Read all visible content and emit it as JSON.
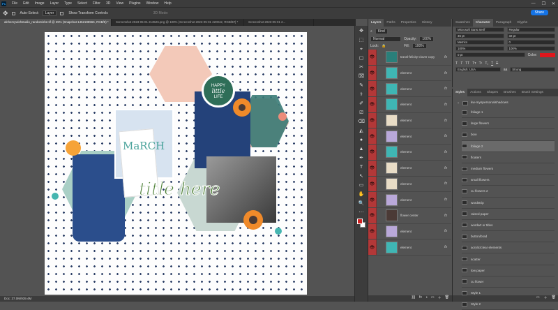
{
  "app": {
    "logo": "Ps"
  },
  "menu": [
    "File",
    "Edit",
    "Image",
    "Layer",
    "Type",
    "Select",
    "Filter",
    "3D",
    "View",
    "Plugins",
    "Window",
    "Help"
  ],
  "window_controls": [
    "—",
    "❐",
    "✕"
  ],
  "options": {
    "auto_select_label": "Auto-Select:",
    "auto_select_value": "Layer",
    "transform_label": "Show Transform Controls",
    "mode_label": "3D Mode:"
  },
  "share_label": "Share",
  "tabs": [
    "alchemywishstudio_randomish2.tif @ 25% (Snapchat-1452198565, RGB/8) *",
    "Screenshot 2023-05-01 213526.png @ 100% (Screenshot 2023-05-01 220042, RGB/8#) *",
    "Screenshot 2023-05-01 2..."
  ],
  "status_text": "Doc: 37.0M/939.4M",
  "canvas": {
    "badge_line1": "HAPPY",
    "badge_line2": "little",
    "badge_line3": "LIFE",
    "title_text": "title here",
    "march_text": "MaRCH"
  },
  "layers_panel": {
    "tabs": [
      "Layers",
      "Paths",
      "Properties",
      "History"
    ],
    "filter_label": "Kind",
    "blend_mode": "Normal",
    "opacity_label": "Opacity:",
    "opacity_value": "100%",
    "lock_label": "Lock:",
    "fill_label": "Fill:",
    "fill_value": "100%",
    "layers": [
      {
        "name": "transl-felicity-clover copy",
        "thumb": "#2a7f7a"
      },
      {
        "name": "element",
        "thumb": "#3fb6b4"
      },
      {
        "name": "element",
        "thumb": "#3fb6b4"
      },
      {
        "name": "element",
        "thumb": "#3fb6b4"
      },
      {
        "name": "element",
        "thumb": "#e8dcc6"
      },
      {
        "name": "element",
        "thumb": "#b9a8d9"
      },
      {
        "name": "element",
        "thumb": "#3fb6b4"
      },
      {
        "name": "element",
        "thumb": "#e8dcc6"
      },
      {
        "name": "element",
        "thumb": "#e8dcc6"
      },
      {
        "name": "element",
        "thumb": "#b9a8d9"
      },
      {
        "name": "flower center",
        "thumb": "#4b3a36"
      },
      {
        "name": "element",
        "thumb": "#b9a8d9"
      },
      {
        "name": "element",
        "thumb": "#3fb6b4"
      }
    ]
  },
  "character_panel": {
    "tabs": [
      "Swatches",
      "Character",
      "Paragraph",
      "Glyphs"
    ],
    "font_family": "Microsoft Sans Serif",
    "font_style": "Regular",
    "size": "36 pt",
    "leading": "32 pt",
    "kerning": "Metrics",
    "tracking": "0",
    "vscale": "100%",
    "hscale": "100%",
    "baseline": "0 pt",
    "color_label": "Color:",
    "language": "English: USA",
    "aa_icon": "aa",
    "antialias": "Strong"
  },
  "styles_panel": {
    "tabs": [
      "Styles",
      "Actions",
      "Shapes",
      "Brushes",
      "Brush Settings"
    ],
    "group": "kw-myspersonalshadows",
    "items": [
      "foliage 1",
      "large flowers",
      "bow",
      "foliage 2",
      "floaters",
      "medium flowers",
      "small flowers",
      "cu flowers 2",
      "wordstrip",
      "raised paper",
      "wordart or titles",
      "button/brad",
      "acrylic/clear elements",
      "scatter",
      "low paper",
      "cu flower",
      "Style 1",
      "Style 2"
    ],
    "selected_index": 3
  },
  "toolbar": [
    "✥",
    "⬚",
    "⌖",
    "▢",
    "✂",
    "⌧",
    "✎",
    "⚕",
    "✐",
    "⎚",
    "⌫",
    "◭",
    "●",
    "▲",
    "✒",
    "T",
    "↖",
    "▭",
    "✋",
    "🔍",
    "⋯"
  ]
}
